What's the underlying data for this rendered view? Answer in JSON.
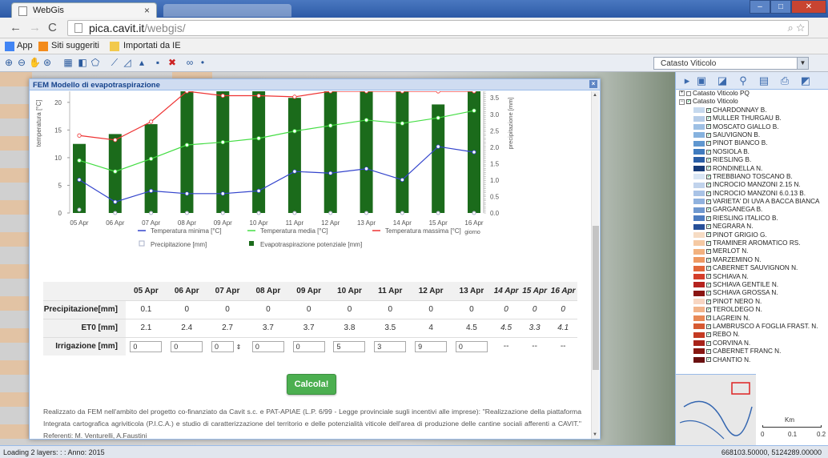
{
  "browser": {
    "tab_title": "WebGis",
    "tab_close": "×",
    "url_host": "pica.cavit.it",
    "url_path": "/webgis/",
    "bookmarks": [
      "App",
      "Siti suggeriti",
      "Importati da IE"
    ]
  },
  "toolbar": {
    "combo_value": "Catasto Viticolo"
  },
  "legend_tree": {
    "groups": [
      "Catasto Viticolo PQ",
      "Catasto Viticolo"
    ],
    "items": [
      {
        "label": "CHARDONNAY B.",
        "color": "#c6d9ee"
      },
      {
        "label": "MULLER THURGAU B.",
        "color": "#b6cde8"
      },
      {
        "label": "MOSCATO GIALLO B.",
        "color": "#9ec0e4"
      },
      {
        "label": "SAUVIGNON B.",
        "color": "#86b2de"
      },
      {
        "label": "PINOT BIANCO B.",
        "color": "#5f97d0"
      },
      {
        "label": "NOSIOLA B.",
        "color": "#3f7bbf"
      },
      {
        "label": "RIESLING B.",
        "color": "#2a5ea6"
      },
      {
        "label": "RONDINELLA N.",
        "color": "#173b78"
      },
      {
        "label": "TREBBIANO TOSCANO B.",
        "color": "#d9e6f5"
      },
      {
        "label": "INCROCIO MANZONI 2.15 N.",
        "color": "#c1d3ec"
      },
      {
        "label": "INCROCIO MANZONI 6.0.13 B.",
        "color": "#a9c3e6"
      },
      {
        "label": "VARIETA' DI UVA A BACCA BIANCA",
        "color": "#90b2de"
      },
      {
        "label": "GARGANEGA B.",
        "color": "#6f98cf"
      },
      {
        "label": "RIESLING ITALICO B.",
        "color": "#4d7cc0"
      },
      {
        "label": "NEGRARA N.",
        "color": "#264f98"
      },
      {
        "label": "PINOT GRIGIO G.",
        "color": "#f6dcc4"
      },
      {
        "label": "TRAMINER AROMATICO RS.",
        "color": "#f5c9a3"
      },
      {
        "label": "MERLOT N.",
        "color": "#f2b27f"
      },
      {
        "label": "MARZEMINO N.",
        "color": "#ee9a63"
      },
      {
        "label": "CABERNET SAUVIGNON N.",
        "color": "#e2673a"
      },
      {
        "label": "SCHIAVA N.",
        "color": "#d43e2a"
      },
      {
        "label": "SCHIAVA GENTILE N.",
        "color": "#b5231e"
      },
      {
        "label": "SCHIAVA GROSSA N.",
        "color": "#8b1512"
      },
      {
        "label": "PINOT NERO N.",
        "color": "#f7d6c2"
      },
      {
        "label": "TEROLDEGO N.",
        "color": "#f2b48a"
      },
      {
        "label": "LAGREIN N.",
        "color": "#e88956"
      },
      {
        "label": "LAMBRUSCO A FOGLIA FRAST. N.",
        "color": "#d65a32"
      },
      {
        "label": "REBO N.",
        "color": "#c43a22"
      },
      {
        "label": "CORVINA N.",
        "color": "#a8231a"
      },
      {
        "label": "CABERNET FRANC N.",
        "color": "#861812"
      },
      {
        "label": "CHANTIO N.",
        "color": "#6a1010"
      }
    ]
  },
  "scale": {
    "unit": "Km",
    "ticks": [
      "0",
      "0.1",
      "0.2"
    ]
  },
  "status": {
    "left": "Loading 2 layers: : : Anno: 2015",
    "right": "668103.50000, 5124289.00000"
  },
  "dialog": {
    "title": "FEM Modello di evapotraspirazione",
    "close": "×",
    "calc_button": "Calcola!",
    "note": "Realizzato da FEM nell'ambito del progetto co-finanziato da Cavit s.c. e PAT-APIAE (L.P. 6/99 - Legge provinciale sugli incentivi alle imprese): \"Realizzazione della piattaforma Integrata cartografica agriviticola (P.I.C.A.) e studio di caratterizzazione del territorio e delle potenzialità viticole dell'area di produzione delle cantine sociali afferenti a CAVIT.\" Referenti: M. Venturelli, A.Faustini"
  },
  "table": {
    "dates": [
      "05 Apr",
      "06 Apr",
      "07 Apr",
      "08 Apr",
      "09 Apr",
      "10 Apr",
      "11 Apr",
      "12 Apr",
      "13 Apr",
      "14 Apr",
      "15 Apr",
      "16 Apr"
    ],
    "prec_label": "Precipitazione[mm]",
    "prec": [
      "0.1",
      "0",
      "0",
      "0",
      "0",
      "0",
      "0",
      "0",
      "0",
      "0",
      "0",
      "0"
    ],
    "et0_label": "ET0 [mm]",
    "et0": [
      "2.1",
      "2.4",
      "2.7",
      "3.7",
      "3.7",
      "3.8",
      "3.5",
      "4",
      "4.5",
      "4.5",
      "3.3",
      "4.1"
    ],
    "irr_label": "Irrigazione [mm]",
    "irr": [
      "0",
      "0",
      "0",
      "0",
      "0",
      "5",
      "3",
      "9",
      "0",
      "--",
      "--",
      "--"
    ]
  },
  "chart_data": {
    "type": "bar+line",
    "categories": [
      "05 Apr",
      "06 Apr",
      "07 Apr",
      "08 Apr",
      "09 Apr",
      "10 Apr",
      "11 Apr",
      "12 Apr",
      "13 Apr",
      "14 Apr",
      "15 Apr",
      "16 Apr"
    ],
    "xlabel": "giorno",
    "ylabel_left": "temperatura [°C]",
    "ylabel_right": "precipitazione [mm]",
    "ylim_left": [
      0,
      22
    ],
    "ylim_right": [
      0,
      3.7
    ],
    "yticks_left": [
      "0",
      "5",
      "10",
      "15",
      "20"
    ],
    "yticks_right": [
      "0.0",
      "0.5",
      "1.0",
      "1.5",
      "2.0",
      "2.5",
      "3.0",
      "3.5"
    ],
    "series": [
      {
        "name": "Temperatura minima [°C]",
        "type": "line",
        "color": "#3344cc",
        "values": [
          6,
          2,
          4,
          3.5,
          3.5,
          4,
          7.5,
          7.2,
          8,
          6,
          12,
          11
        ]
      },
      {
        "name": "Temperatura media [°C]",
        "type": "line",
        "color": "#44dd44",
        "values": [
          9.5,
          7.5,
          9.8,
          12.3,
          12.8,
          13.5,
          14.8,
          15.8,
          16.8,
          16.2,
          17.2,
          18.5
        ]
      },
      {
        "name": "Temperatura massima [°C]",
        "type": "line",
        "color": "#ee3333",
        "values": [
          14,
          13.2,
          16.5,
          22,
          21.2,
          21.2,
          21,
          22,
          22,
          22,
          22,
          22
        ]
      },
      {
        "name": "Precipitazione [mm]",
        "type": "scatter",
        "color": "#aab0c8",
        "values": [
          0.1,
          0,
          0,
          0,
          0,
          0,
          0,
          0,
          0,
          0,
          0,
          0
        ]
      },
      {
        "name": "Evapotraspirazione potenziale [mm]",
        "type": "bar",
        "color": "#1b6b1b",
        "values": [
          2.1,
          2.4,
          2.7,
          3.7,
          3.7,
          3.8,
          3.5,
          4,
          4.5,
          4.5,
          3.3,
          4.1
        ]
      }
    ],
    "legend_placement": "bottom"
  }
}
